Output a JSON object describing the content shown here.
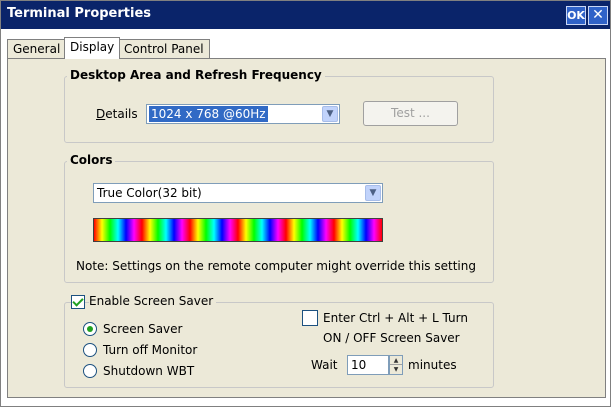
{
  "window": {
    "title": "Terminal Properties",
    "ok_label": "OK",
    "close_glyph": "✕"
  },
  "tabs": [
    {
      "label": "General",
      "active": false
    },
    {
      "label": "Display",
      "active": true
    },
    {
      "label": "Control Panel",
      "active": false
    }
  ],
  "desktop": {
    "title": "Desktop Area and Refresh Frequency",
    "details_label": "Details",
    "resolution_value": "1024 x 768 @60Hz",
    "test_label": "Test ..."
  },
  "colors": {
    "title": "Colors",
    "depth_value": "True Color(32 bit)",
    "note": "Note: Settings on the remote computer might override this setting"
  },
  "screensaver": {
    "enable_label": "Enable Screen Saver",
    "enable_checked": true,
    "options": [
      {
        "label": "Screen Saver",
        "checked": true
      },
      {
        "label": "Turn off Monitor",
        "checked": false
      },
      {
        "label": "Shutdown WBT",
        "checked": false
      }
    ],
    "ctrl_alt_line1": "Enter Ctrl + Alt + L Turn",
    "ctrl_alt_line2": "ON / OFF Screen Saver",
    "ctrl_alt_checked": false,
    "wait_label": "Wait",
    "wait_value": "10",
    "minutes_label": "minutes"
  },
  "theme": {
    "titlebar_bg": "#0a246a",
    "selection_bg": "#316ac5",
    "check_color": "#21a121"
  }
}
